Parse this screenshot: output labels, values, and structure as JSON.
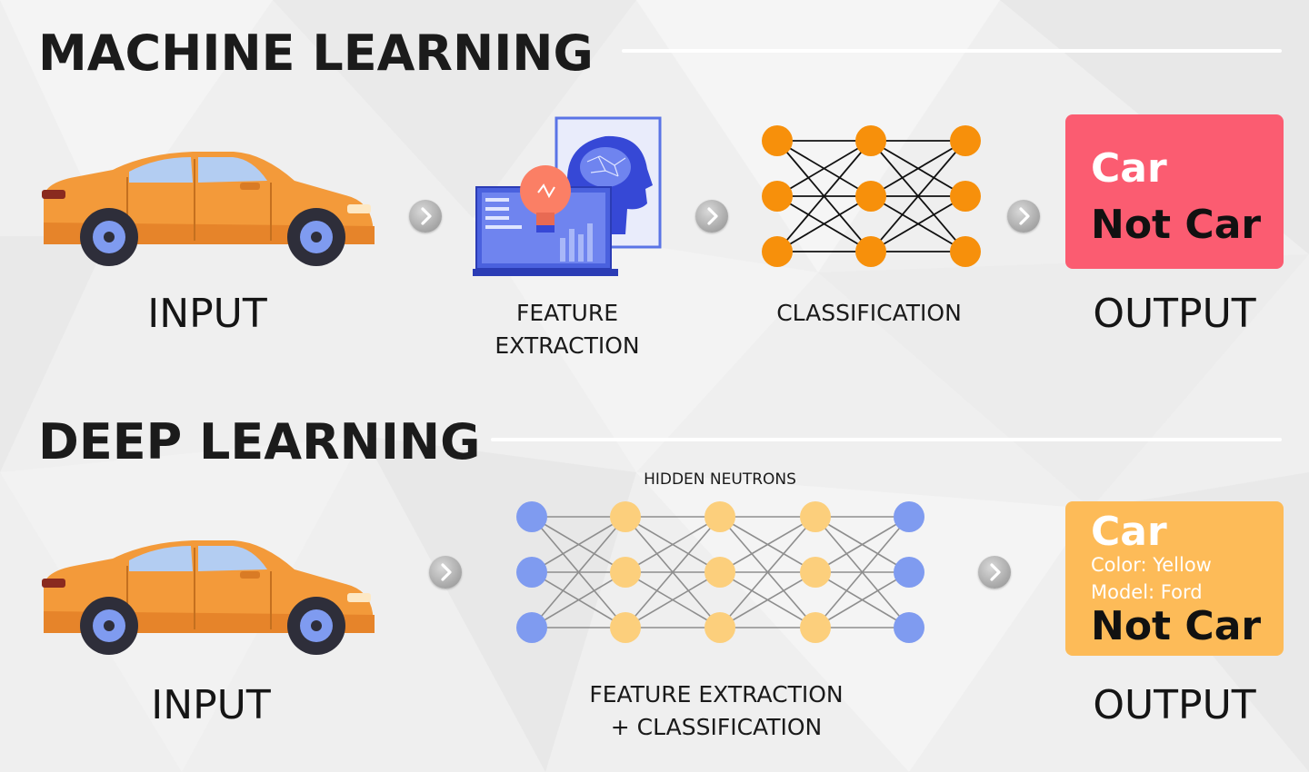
{
  "machine_learning": {
    "title": "MACHINE LEARNING",
    "input_label": "INPUT",
    "feature_label_line1": "FEATURE",
    "feature_label_line2": "EXTRACTION",
    "classification_label": "CLASSIFICATION",
    "output_label": "OUTPUT",
    "output_box": {
      "line1": "Car",
      "line2": "Not Car",
      "color": "#fb5c71"
    }
  },
  "deep_learning": {
    "title": "DEEP LEARNING",
    "hidden_label": "HIDDEN NEUTRONS",
    "input_label": "INPUT",
    "process_label_line1": "FEATURE EXTRACTION",
    "process_label_line2": "+ CLASSIFICATION",
    "output_label": "OUTPUT",
    "output_box": {
      "line1": "Car",
      "detail1": "Color: Yellow",
      "detail2": "Model: Ford",
      "line2": "Not Car",
      "color": "#fdbb58"
    }
  },
  "colors": {
    "car_body": "#f39a3a",
    "ml_nodes": "#f7900b",
    "dl_outer_nodes": "#7f9bf0",
    "dl_hidden_nodes": "#fccf7c"
  },
  "icons": [
    "car-icon",
    "laptop-icon",
    "lightbulb-icon",
    "brain-head-icon",
    "chevron-right-icon"
  ]
}
